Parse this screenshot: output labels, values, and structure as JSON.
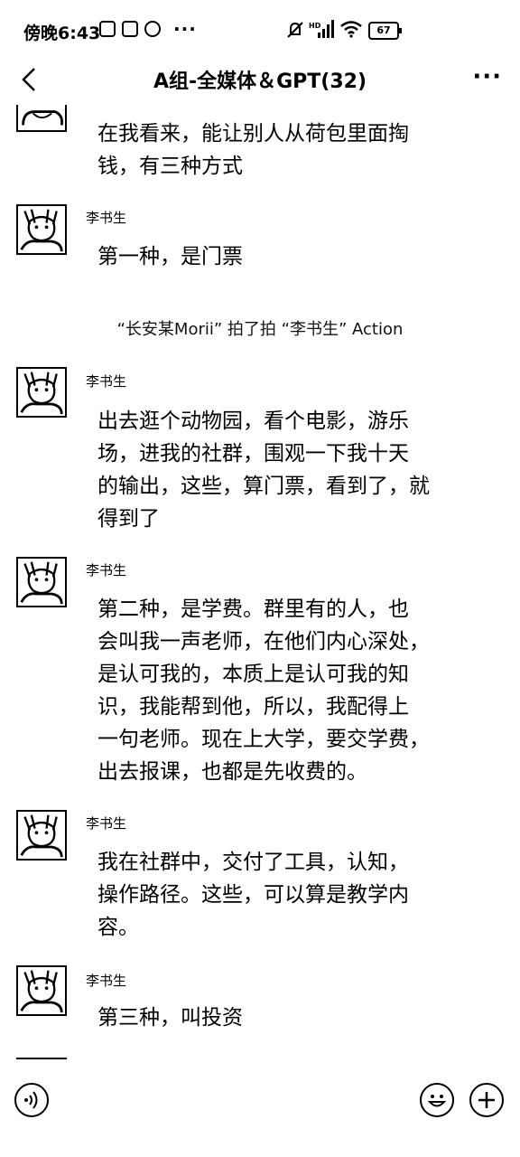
{
  "status_bar": {
    "time": "傍晚6:43",
    "dots": "···",
    "battery": "67"
  },
  "header": {
    "title": "A组-全媒体＆GPT(32)",
    "more": "···"
  },
  "messages": [
    {
      "sender": "",
      "text": "在我看来，能让别人从荷包里面掏\n钱，有三种方式"
    },
    {
      "sender": "李书生",
      "text": "第一种，是门票"
    },
    {
      "system": "“长安某Morii” 拍了拍 “李书生” Action"
    },
    {
      "sender": "李书生",
      "text": "出去逛个动物园，看个电影，游乐\n场，进我的社群，围观一下我十天\n的输出，这些，算门票，看到了，就\n得到了"
    },
    {
      "sender": "李书生",
      "text": "第二种，是学费。群里有的人，也\n会叫我一声老师，在他们内心深处，\n是认可我的，本质上是认可我的知\n识，我能帮到他，所以，我配得上\n一句老师。现在上大学，要交学费，\n出去报课，也都是先收费的。"
    },
    {
      "sender": "李书生",
      "text": "我在社群中，交付了工具，认知，\n操作路径。这些，可以算是教学内\n容。"
    },
    {
      "sender": "李书生",
      "text": "第三种，叫投资"
    }
  ]
}
